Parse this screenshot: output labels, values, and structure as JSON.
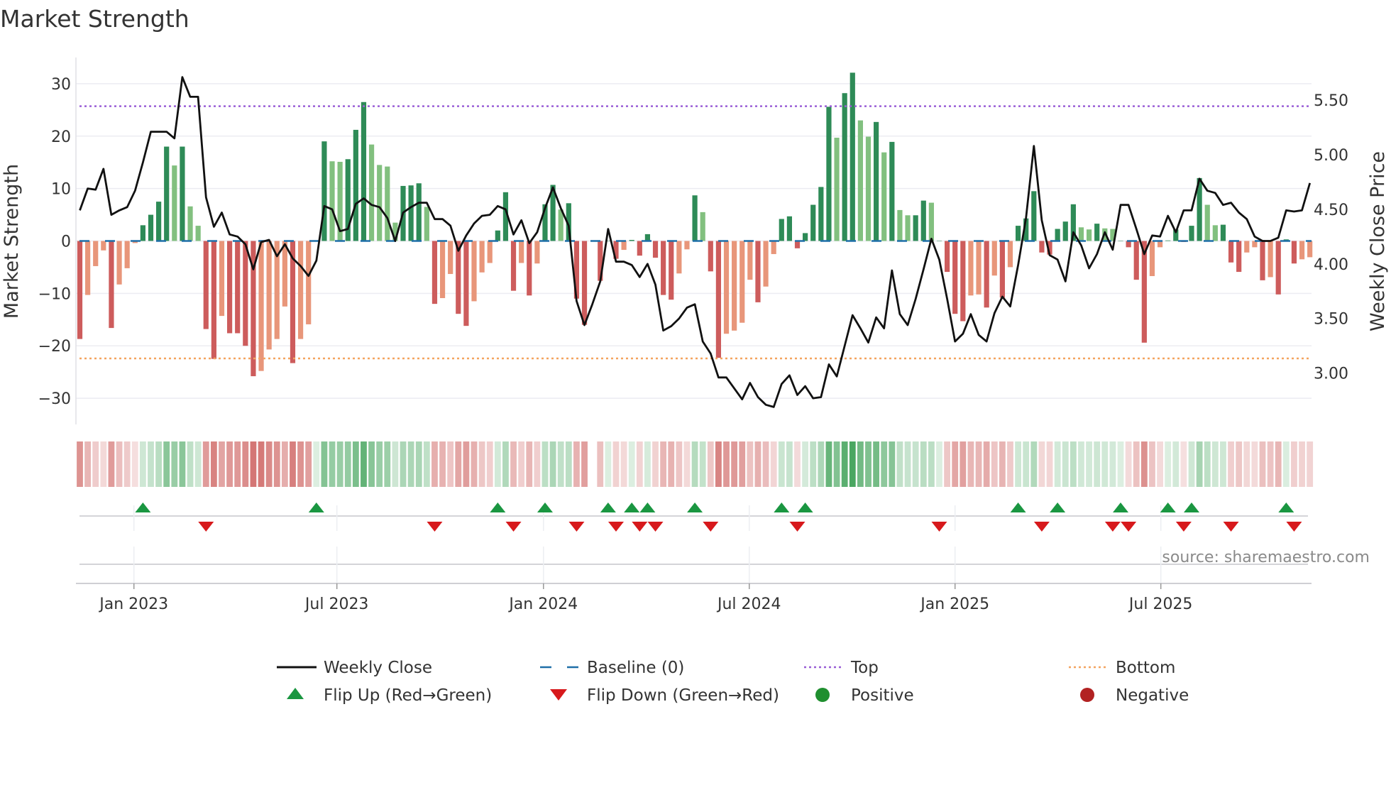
{
  "title": "Market Strength",
  "source": "source: sharemaestro.com",
  "colors": {
    "pos_dark": "#2e8b57",
    "pos_light": "#82c07f",
    "neg_dark": "#cd5c5c",
    "neg_light": "#e8967a",
    "line": "#111111",
    "baseline": "#1f6fa8",
    "top": "#9a5fd6",
    "bottom": "#f4a460",
    "flip_up": "#1a9641",
    "flip_down": "#d7191c",
    "positive": "#1f8f2f",
    "negative": "#b22222"
  },
  "legend": [
    {
      "label": "Weekly Close",
      "symbol": "solid-line",
      "color": "#111111"
    },
    {
      "label": "Baseline (0)",
      "symbol": "dashed-line",
      "color": "#1f6fa8"
    },
    {
      "label": "Top",
      "symbol": "dotted-line",
      "color": "#9a5fd6"
    },
    {
      "label": "Bottom",
      "symbol": "dotted-line",
      "color": "#f4a460"
    },
    {
      "label": "Flip Up (Red→Green)",
      "symbol": "triangle-up",
      "color": "#1a9641"
    },
    {
      "label": "Flip Down (Green→Red)",
      "symbol": "triangle-down",
      "color": "#d7191c"
    },
    {
      "label": "Positive",
      "symbol": "circle",
      "color": "#1f8f2f"
    },
    {
      "label": "Negative",
      "symbol": "circle",
      "color": "#b22222"
    }
  ],
  "chart_data": {
    "type": "bar",
    "title": "Market Strength",
    "ylabel": "Market Strength",
    "y2label": "Weekly Close Price",
    "ylim": [
      -35,
      35
    ],
    "y2lim": [
      2.53,
      5.89
    ],
    "yticks": [
      30,
      20,
      10,
      0,
      -10,
      -20,
      -30
    ],
    "yticklabels": [
      "30",
      "20",
      "10",
      "0",
      "−10",
      "−20",
      "−30"
    ],
    "y2ticks": [
      5.5,
      5.0,
      4.5,
      4.0,
      3.5,
      3.0
    ],
    "y2ticklabels": [
      "5.50",
      "5.00",
      "4.50",
      "4.00",
      "3.50",
      "3.00"
    ],
    "top_level": 25.7,
    "bottom_level": -22.4,
    "baseline": 0,
    "x_unit": "week index",
    "xticks": [
      6.86,
      32.6,
      58.8,
      84.9,
      111.0,
      137.1
    ],
    "xticklabels": [
      "Jan 2023",
      "Jul 2023",
      "Jan 2024",
      "Jul 2024",
      "Jan 2025",
      "Jul 2025"
    ],
    "strength": [
      -18.7,
      -10.3,
      -4.8,
      -1.8,
      -16.6,
      -8.3,
      -5.2,
      -0.4,
      3,
      5,
      7.5,
      18,
      14.4,
      18,
      6.6,
      2.9,
      -16.8,
      -22.5,
      -14.3,
      -17.6,
      -17.6,
      -20,
      -25.8,
      -24.8,
      -20.7,
      -18.7,
      -12.5,
      -23.3,
      -18.7,
      -15.9,
      0.1,
      19,
      15.2,
      15.1,
      15.6,
      21.2,
      26.5,
      18.4,
      14.5,
      14.2,
      3.5,
      10.5,
      10.6,
      11,
      6.5,
      -12,
      -10.9,
      -6.3,
      -13.9,
      -16.2,
      -11.5,
      -6,
      -4.2,
      2,
      9.3,
      -9.5,
      -4.2,
      -10.4,
      -4.3,
      7,
      10.7,
      6,
      7.2,
      -11,
      -16,
      null,
      -7.6,
      0,
      -3.4,
      -1.7,
      0.2,
      -2.8,
      1.3,
      -3.2,
      -10.3,
      -11.2,
      -6.2,
      -1.6,
      8.7,
      5.5,
      -5.8,
      -22.3,
      -17.7,
      -17.1,
      -15.6,
      -7.4,
      -11.7,
      -8.7,
      -2.5,
      4.2,
      4.7,
      -1.4,
      1.5,
      6.9,
      10.3,
      25.6,
      19.7,
      28.2,
      32.1,
      23,
      19.9,
      22.7,
      16.9,
      18.9,
      5.9,
      4.9,
      4.9,
      7.7,
      7.3,
      0,
      -5.9,
      -13.9,
      -15.3,
      -10.4,
      -10.2,
      -12.7,
      -6.6,
      -10.8,
      -5,
      2.9,
      4.3,
      9.5,
      -2.2,
      -2.6,
      2.3,
      3.7,
      7,
      2.6,
      2.2,
      3.3,
      2.4,
      2.3,
      0,
      -1.2,
      -7.4,
      -19.4,
      -6.7,
      -1.2,
      0.1,
      2.2,
      -0.2,
      2.9,
      12,
      6.9,
      3,
      3.1,
      -4.1,
      -5.9,
      -2.2,
      -1.2,
      -7.5,
      -6.9,
      -10.2,
      0.3,
      -4.3,
      -3.5,
      -3.1
    ],
    "weekly_close": [
      4.49,
      4.69,
      4.68,
      4.87,
      4.45,
      4.49,
      4.52,
      4.67,
      4.93,
      5.21,
      5.21,
      5.21,
      5.15,
      5.71,
      5.53,
      5.53,
      4.61,
      4.34,
      4.47,
      4.27,
      4.25,
      4.18,
      3.95,
      4.2,
      4.22,
      4.07,
      4.18,
      4.05,
      3.98,
      3.89,
      4.03,
      4.53,
      4.5,
      4.3,
      4.32,
      4.55,
      4.6,
      4.54,
      4.52,
      4.42,
      4.21,
      4.47,
      4.52,
      4.56,
      4.56,
      4.41,
      4.41,
      4.35,
      4.12,
      4.26,
      4.37,
      4.44,
      4.45,
      4.53,
      4.5,
      4.27,
      4.4,
      4.19,
      4.29,
      4.51,
      4.7,
      4.51,
      4.35,
      3.66,
      3.44,
      3.63,
      3.84,
      4.32,
      4.02,
      4.02,
      3.99,
      3.88,
      4.0,
      3.81,
      3.39,
      3.43,
      3.5,
      3.6,
      3.63,
      3.29,
      3.18,
      2.96,
      2.96,
      2.86,
      2.76,
      2.91,
      2.78,
      2.71,
      2.69,
      2.9,
      2.98,
      2.8,
      2.88,
      2.77,
      2.78,
      3.08,
      2.97,
      3.25,
      3.53,
      3.41,
      3.28,
      3.51,
      3.41,
      3.94,
      3.54,
      3.44,
      3.68,
      3.95,
      4.23,
      4.04,
      3.68,
      3.29,
      3.36,
      3.54,
      3.35,
      3.29,
      3.55,
      3.7,
      3.61,
      3.99,
      4.42,
      5.08,
      4.4,
      4.08,
      4.04,
      3.84,
      4.29,
      4.17,
      3.96,
      4.09,
      4.29,
      4.13,
      4.54,
      4.54,
      4.32,
      4.09,
      4.26,
      4.25,
      4.44,
      4.29,
      4.49,
      4.49,
      4.78,
      4.67,
      4.65,
      4.54,
      4.56,
      4.47,
      4.41,
      4.25,
      4.21,
      4.21,
      4.24,
      4.49,
      4.48,
      4.49,
      4.74
    ],
    "flip_up_weeks": [
      8,
      30,
      53,
      59,
      67,
      70,
      72,
      78,
      89,
      92,
      119,
      124,
      132,
      138,
      141,
      153
    ],
    "flip_down_weeks": [
      16,
      45,
      55,
      63,
      68,
      71,
      73,
      80,
      91,
      109,
      122,
      131,
      133,
      140,
      146,
      154
    ]
  }
}
